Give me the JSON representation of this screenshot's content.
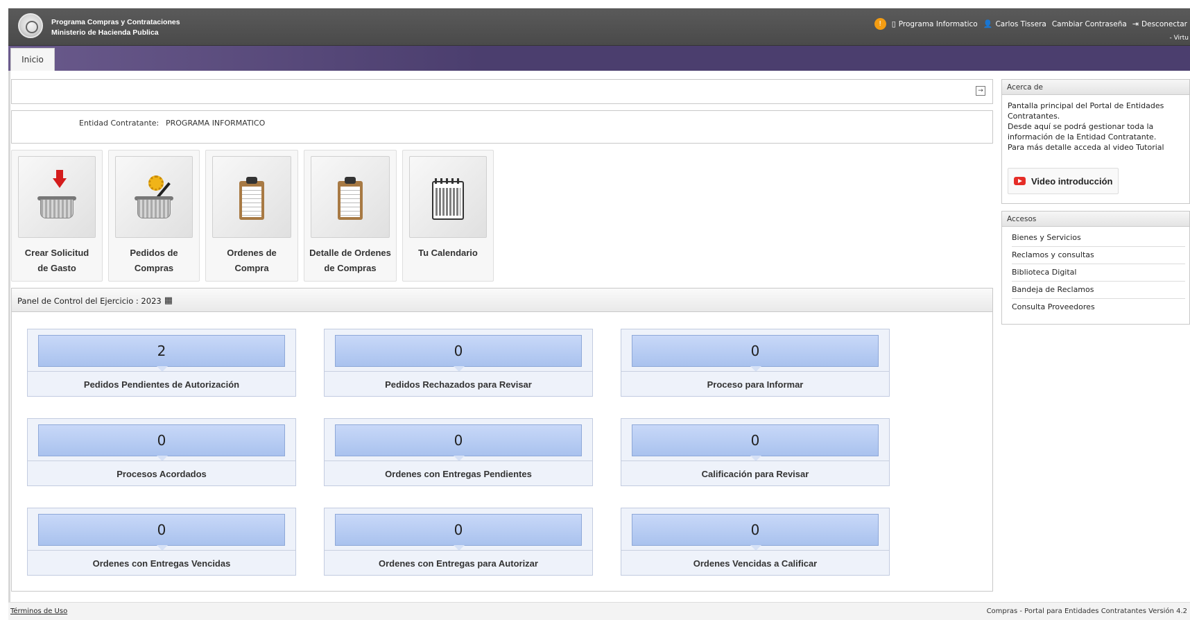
{
  "header": {
    "brand_line1": "Programa Compras y Contrataciones",
    "brand_line2": "Ministerio de Hacienda Publica",
    "notification_count": "!",
    "links": [
      {
        "icon": "building-icon",
        "glyph": "▯",
        "label": "Programa Informatico"
      },
      {
        "icon": "user-icon",
        "glyph": "👤",
        "label": "Carlos Tissera"
      },
      {
        "icon": "",
        "glyph": "",
        "label": "Cambiar Contraseña"
      },
      {
        "icon": "logout-icon",
        "glyph": "⇥",
        "label": "Desconectar"
      }
    ],
    "virtual_label": "- Virtu"
  },
  "nav": {
    "tab_inicio": "Inicio"
  },
  "entity": {
    "label": "Entidad Contratante:",
    "value": "PROGRAMA INFORMATICO"
  },
  "tiles": [
    {
      "label": "Crear Solicitud de Gasto",
      "icon": "basket-download-icon"
    },
    {
      "label": "Pedidos de Compras",
      "icon": "basket-gear-icon"
    },
    {
      "label": "Ordenes de Compra",
      "icon": "clipboard-icon"
    },
    {
      "label": "Detalle de Ordenes de Compras",
      "icon": "clipboard-icon"
    },
    {
      "label": "Tu Calendario",
      "icon": "calendar-icon"
    }
  ],
  "panel": {
    "title": "Panel de Control del Ejercicio : 2023",
    "cards": [
      {
        "value": "2",
        "label": "Pedidos Pendientes de Autorización"
      },
      {
        "value": "0",
        "label": "Pedidos Rechazados para Revisar"
      },
      {
        "value": "0",
        "label": "Proceso para Informar"
      },
      {
        "value": "0",
        "label": "Procesos Acordados"
      },
      {
        "value": "0",
        "label": "Ordenes con Entregas Pendientes"
      },
      {
        "value": "0",
        "label": "Calificación para Revisar"
      },
      {
        "value": "0",
        "label": "Ordenes con Entregas Vencidas"
      },
      {
        "value": "0",
        "label": "Ordenes con Entregas para Autorizar"
      },
      {
        "value": "0",
        "label": "Ordenes Vencidas a Calificar"
      }
    ]
  },
  "sidebar": {
    "about_title": "Acerca de",
    "about_text": "Pantalla principal del Portal de Entidades Contratantes.\nDesde aquí se podrá gestionar toda la información de la Entidad Contratante.\nPara más detalle acceda al video Tutorial",
    "video_label": "Video introducción",
    "accesos_title": "Accesos",
    "accesos": [
      "Bienes y Servicios",
      "Reclamos y consultas",
      "Biblioteca Digital",
      "Bandeja de Reclamos",
      "Consulta Proveedores"
    ]
  },
  "footer": {
    "terms": "Términos de Uso",
    "version": "Compras - Portal para Entidades Contratantes Versión 4.2"
  },
  "colors": {
    "header_bg": "#4f4f4f",
    "nav_bg": "#4b3e6e",
    "card_value_bg": "#b9cdf2",
    "notification": "#f39c12"
  }
}
